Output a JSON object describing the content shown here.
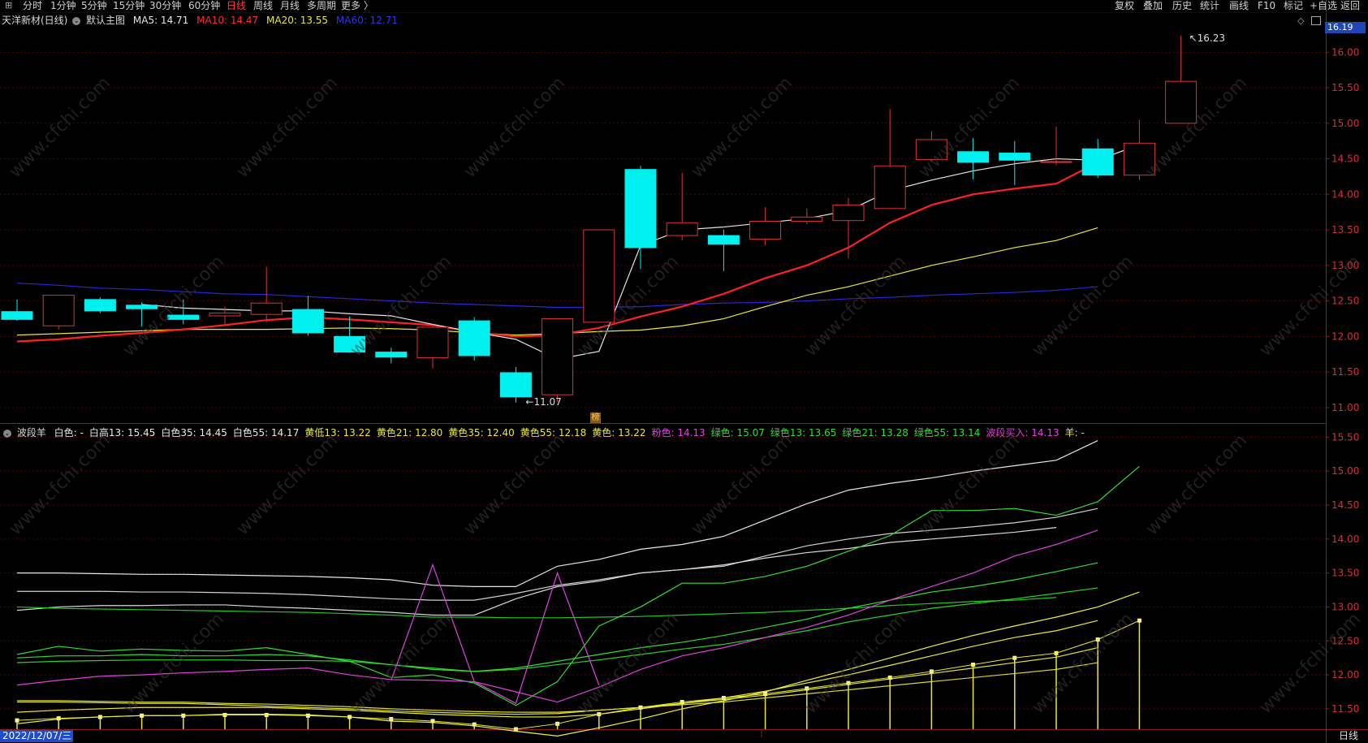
{
  "toolbar": {
    "left_items": [
      "分时",
      "1分钟",
      "5分钟",
      "15分钟",
      "30分钟",
      "60分钟",
      "日线",
      "周线",
      "月线",
      "多周期",
      "更多 〉"
    ],
    "active_item": "日线",
    "right_items": [
      "复权",
      "叠加",
      "历史",
      "统计",
      "画线",
      "F10",
      "标记",
      "+自选",
      "返回"
    ]
  },
  "main_legend": {
    "stock": "天洋新材(日线)",
    "template": "默认主图",
    "ma5": "MA5: 14.71",
    "ma10": "MA10: 14.47",
    "ma20": "MA20: 13.55",
    "ma60": "MA60: 12.71"
  },
  "sub_legend": {
    "indicator": "波段羊",
    "items": [
      {
        "text": "白色: -",
        "color": "#e6e6e6"
      },
      {
        "text": "白高13: 15.45",
        "color": "#e6e6e6"
      },
      {
        "text": "白色35: 14.45",
        "color": "#e6e6e6"
      },
      {
        "text": "白色55: 14.17",
        "color": "#e6e6e6"
      },
      {
        "text": "黄低13: 13.22",
        "color": "#e8e832"
      },
      {
        "text": "黄色21: 12.80",
        "color": "#e8e832"
      },
      {
        "text": "黄色35: 12.40",
        "color": "#e8e832"
      },
      {
        "text": "黄色55: 12.18",
        "color": "#e8e832"
      },
      {
        "text": "黄色: 13.22",
        "color": "#e8e832"
      },
      {
        "text": "粉色: 14.13",
        "color": "#e040e0"
      },
      {
        "text": "绿色: 15.07",
        "color": "#32dc32"
      },
      {
        "text": "绿色13: 13.65",
        "color": "#32dc32"
      },
      {
        "text": "绿色21: 13.28",
        "color": "#32dc32"
      },
      {
        "text": "绿色55: 13.14",
        "color": "#32dc32"
      },
      {
        "text": "波段买入: 14.13",
        "color": "#e040e0"
      },
      {
        "text": "羊: -",
        "color": "#e8e832"
      }
    ]
  },
  "price_badge": "16.19",
  "main_axis_labels": [
    "16.00",
    "15.50",
    "15.00",
    "14.50",
    "14.00",
    "13.50",
    "13.00",
    "12.50",
    "12.00",
    "11.50",
    "11.00"
  ],
  "sub_axis_labels": [
    "15.50",
    "15.00",
    "14.50",
    "14.00",
    "13.50",
    "13.00",
    "12.50",
    "12.00",
    "11.50"
  ],
  "high_label": "16.23",
  "low_label": "11.07",
  "mark_badge": "榜",
  "date_label": "2022/12/07/三",
  "period_label": "日线",
  "colors": {
    "up": "#e03232",
    "down": "#00f0f0",
    "ma5": "#e6e6e6",
    "ma10": "#ff2020",
    "ma20": "#e8e832",
    "ma60": "#2828dc",
    "grid": "#5a0000",
    "axis": "#8c1c1c"
  },
  "chart_data": {
    "type": "candlestick",
    "main_ylim": [
      10.85,
      16.3
    ],
    "sub_ylim": [
      11.2,
      15.6
    ],
    "candles": [
      {
        "o": 12.35,
        "h": 12.52,
        "l": 12.22,
        "c": 12.24
      },
      {
        "o": 12.15,
        "h": 12.58,
        "l": 12.1,
        "c": 12.58
      },
      {
        "o": 12.52,
        "h": 12.55,
        "l": 12.33,
        "c": 12.36
      },
      {
        "o": 12.44,
        "h": 12.48,
        "l": 12.14,
        "c": 12.39
      },
      {
        "o": 12.3,
        "h": 12.52,
        "l": 12.17,
        "c": 12.24
      },
      {
        "o": 12.29,
        "h": 12.42,
        "l": 12.15,
        "c": 12.33
      },
      {
        "o": 12.31,
        "h": 12.98,
        "l": 12.2,
        "c": 12.47
      },
      {
        "o": 12.38,
        "h": 12.57,
        "l": 12.01,
        "c": 12.05
      },
      {
        "o": 12.0,
        "h": 12.28,
        "l": 11.77,
        "c": 11.78
      },
      {
        "o": 11.78,
        "h": 11.84,
        "l": 11.62,
        "c": 11.71
      },
      {
        "o": 11.7,
        "h": 12.17,
        "l": 11.55,
        "c": 12.13
      },
      {
        "o": 12.22,
        "h": 12.27,
        "l": 11.66,
        "c": 11.73
      },
      {
        "o": 11.49,
        "h": 11.57,
        "l": 11.07,
        "c": 11.15
      },
      {
        "o": 11.18,
        "h": 12.25,
        "l": 11.08,
        "c": 12.25
      },
      {
        "o": 12.2,
        "h": 13.5,
        "l": 12.82,
        "c": 13.5
      },
      {
        "o": 14.35,
        "h": 14.4,
        "l": 12.95,
        "c": 13.25
      },
      {
        "o": 13.42,
        "h": 14.3,
        "l": 13.35,
        "c": 13.6
      },
      {
        "o": 13.42,
        "h": 13.5,
        "l": 12.92,
        "c": 13.3
      },
      {
        "o": 13.37,
        "h": 13.82,
        "l": 13.28,
        "c": 13.62
      },
      {
        "o": 13.62,
        "h": 13.8,
        "l": 13.58,
        "c": 13.68
      },
      {
        "o": 13.63,
        "h": 13.95,
        "l": 13.1,
        "c": 13.85
      },
      {
        "o": 13.8,
        "h": 15.2,
        "l": 13.8,
        "c": 14.4
      },
      {
        "o": 14.49,
        "h": 14.89,
        "l": 14.46,
        "c": 14.77
      },
      {
        "o": 14.6,
        "h": 14.79,
        "l": 14.21,
        "c": 14.45
      },
      {
        "o": 14.58,
        "h": 14.75,
        "l": 14.13,
        "c": 14.48
      },
      {
        "o": 14.45,
        "h": 14.95,
        "l": 14.41,
        "c": 14.46
      },
      {
        "o": 14.64,
        "h": 14.78,
        "l": 14.23,
        "c": 14.27
      },
      {
        "o": 14.27,
        "h": 15.05,
        "l": 14.2,
        "c": 14.72
      },
      {
        "o": 15.0,
        "h": 16.23,
        "l": 15.0,
        "c": 15.59
      }
    ],
    "ma5": [
      null,
      12.45,
      12.4,
      12.38,
      12.36,
      12.36,
      12.32,
      12.29,
      12.17,
      12.06,
      11.96,
      11.68,
      11.79,
      13.28,
      13.5,
      13.54,
      13.6,
      13.66,
      13.77,
      14.05,
      14.2,
      14.33,
      14.43,
      14.5,
      14.48,
      14.7
    ],
    "ma10": [
      11.93,
      11.96,
      12.01,
      12.05,
      12.1,
      12.16,
      12.23,
      12.27,
      12.24,
      12.2,
      12.16,
      12.06,
      12.0,
      12.02,
      12.12,
      12.28,
      12.42,
      12.6,
      12.82,
      13.0,
      13.25,
      13.6,
      13.85,
      14.0,
      14.08,
      14.15,
      14.45
    ],
    "ma20": [
      12.02,
      12.04,
      12.06,
      12.08,
      12.1,
      12.1,
      12.1,
      12.11,
      12.12,
      12.11,
      12.09,
      12.05,
      12.02,
      12.04,
      12.07,
      12.09,
      12.15,
      12.25,
      12.42,
      12.58,
      12.7,
      12.85,
      13.0,
      13.12,
      13.25,
      13.35,
      13.53
    ],
    "ma60": [
      12.75,
      12.72,
      12.68,
      12.66,
      12.63,
      12.6,
      12.59,
      12.56,
      12.53,
      12.5,
      12.47,
      12.45,
      12.43,
      12.41,
      12.41,
      12.42,
      12.45,
      12.47,
      12.48,
      12.5,
      12.53,
      12.55,
      12.58,
      12.6,
      12.62,
      12.65,
      12.7
    ],
    "sub_white_hi": [
      13.5,
      13.5,
      13.49,
      13.48,
      13.48,
      13.47,
      13.46,
      13.45,
      13.43,
      13.4,
      13.32,
      13.3,
      13.3,
      13.6,
      13.7,
      13.85,
      13.92,
      14.04,
      14.28,
      14.52,
      14.72,
      14.82,
      14.9,
      15.0,
      15.08,
      15.16,
      15.45
    ],
    "sub_white35": [
      13.23,
      13.23,
      13.23,
      13.22,
      13.22,
      13.21,
      13.2,
      13.18,
      13.15,
      13.12,
      13.1,
      13.1,
      13.2,
      13.32,
      13.4,
      13.5,
      13.55,
      13.6,
      13.75,
      13.9,
      14.0,
      14.08,
      14.13,
      14.18,
      14.24,
      14.32,
      14.45
    ],
    "sub_white55": [
      12.95,
      13.0,
      13.02,
      13.02,
      13.03,
      13.03,
      13.0,
      12.98,
      12.95,
      12.92,
      12.88,
      12.88,
      13.12,
      13.3,
      13.38,
      13.5,
      13.55,
      13.62,
      13.72,
      13.8,
      13.86,
      13.95,
      14.0,
      14.05,
      14.1,
      14.17
    ],
    "sub_green": [
      12.3,
      12.42,
      12.35,
      12.38,
      12.36,
      12.35,
      12.4,
      12.3,
      12.2,
      11.96,
      12.0,
      11.88,
      11.55,
      11.9,
      12.72,
      13.0,
      13.35,
      13.35,
      13.45,
      13.6,
      13.82,
      14.05,
      14.42,
      14.42,
      14.45,
      14.35,
      14.55,
      15.07
    ],
    "sub_green13": [
      12.25,
      12.28,
      12.28,
      12.3,
      12.28,
      12.28,
      12.3,
      12.28,
      12.22,
      12.15,
      12.08,
      12.05,
      12.1,
      12.2,
      12.3,
      12.4,
      12.48,
      12.58,
      12.7,
      12.82,
      12.98,
      13.1,
      13.22,
      13.3,
      13.4,
      13.52,
      13.65
    ],
    "sub_green21": [
      12.18,
      12.2,
      12.21,
      12.22,
      12.22,
      12.22,
      12.21,
      12.21,
      12.2,
      12.15,
      12.1,
      12.05,
      12.08,
      12.15,
      12.22,
      12.3,
      12.38,
      12.45,
      12.55,
      12.65,
      12.78,
      12.88,
      12.98,
      13.05,
      13.12,
      13.2,
      13.28
    ],
    "sub_green55": [
      13.0,
      12.98,
      12.97,
      12.96,
      12.95,
      12.94,
      12.93,
      12.92,
      12.9,
      12.88,
      12.85,
      12.85,
      12.84,
      12.84,
      12.85,
      12.86,
      12.88,
      12.9,
      12.92,
      12.95,
      12.98,
      13.02,
      13.05,
      13.08,
      13.1,
      13.14
    ],
    "sub_pink": [
      11.85,
      11.92,
      11.98,
      12.0,
      12.03,
      12.05,
      12.08,
      12.1,
      12.0,
      11.93,
      11.92,
      11.9,
      11.75,
      11.6,
      11.82,
      12.08,
      12.28,
      12.4,
      12.55,
      12.7,
      12.88,
      13.1,
      13.3,
      13.5,
      13.75,
      13.92,
      14.13
    ],
    "sub_buy_peak": [
      {
        "x": 9,
        "v": 11.92
      },
      {
        "x": 10,
        "v": 13.62
      },
      {
        "x": 11,
        "v": 11.9
      },
      {
        "x": 12,
        "v": 11.58
      },
      {
        "x": 13,
        "v": 13.5
      },
      {
        "x": 14,
        "v": 11.85
      }
    ],
    "sub_yellow_lo": [
      11.28,
      11.35,
      11.38,
      11.4,
      11.4,
      11.42,
      11.42,
      11.41,
      11.38,
      11.32,
      11.3,
      11.25,
      11.17,
      11.1,
      11.22,
      11.35,
      11.5,
      11.62,
      11.75,
      11.92,
      12.08,
      12.25,
      12.42,
      12.58,
      12.72,
      12.85,
      13.0,
      13.22
    ],
    "sub_yellow21": [
      11.45,
      11.48,
      11.5,
      11.52,
      11.52,
      11.52,
      11.52,
      11.5,
      11.48,
      11.45,
      11.42,
      11.4,
      11.38,
      11.38,
      11.42,
      11.5,
      11.58,
      11.66,
      11.76,
      11.88,
      12.0,
      12.14,
      12.28,
      12.42,
      12.55,
      12.65,
      12.8
    ],
    "sub_yellow35": [
      11.6,
      11.6,
      11.59,
      11.58,
      11.58,
      11.56,
      11.54,
      11.52,
      11.5,
      11.47,
      11.45,
      11.43,
      11.42,
      11.43,
      11.48,
      11.52,
      11.58,
      11.64,
      11.7,
      11.78,
      11.86,
      11.94,
      12.02,
      12.1,
      12.18,
      12.26,
      12.4
    ],
    "sub_yellow55": [
      11.62,
      11.62,
      11.61,
      11.6,
      11.6,
      11.58,
      11.57,
      11.55,
      11.53,
      11.5,
      11.48,
      11.46,
      11.45,
      11.45,
      11.48,
      11.52,
      11.56,
      11.6,
      11.66,
      11.72,
      11.78,
      11.84,
      11.9,
      11.96,
      12.02,
      12.08,
      12.18
    ],
    "sub_sheep": [
      11.33,
      11.36,
      11.38,
      11.4,
      11.4,
      11.41,
      11.41,
      11.4,
      11.38,
      11.35,
      11.32,
      11.27,
      11.2,
      11.28,
      11.42,
      11.52,
      11.6,
      11.66,
      11.72,
      11.8,
      11.88,
      11.96,
      12.05,
      12.15,
      12.25,
      12.32,
      12.52,
      12.8
    ]
  }
}
